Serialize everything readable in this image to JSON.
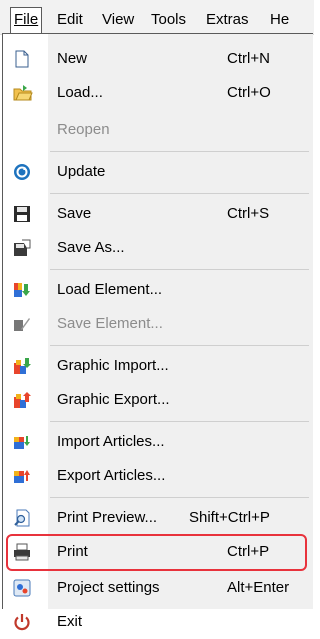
{
  "menubar": {
    "items": [
      {
        "label": "File"
      },
      {
        "label": "Edit"
      },
      {
        "label": "View"
      },
      {
        "label": "Tools"
      },
      {
        "label": "Extras"
      },
      {
        "label": "He"
      }
    ]
  },
  "file_menu": {
    "items": [
      {
        "icon": "new-file-icon",
        "label": "New",
        "shortcut": "Ctrl+N",
        "enabled": true
      },
      {
        "icon": "load-folder-icon",
        "label": "Load...",
        "shortcut": "Ctrl+O",
        "enabled": true
      },
      {
        "icon": "",
        "label": "Reopen",
        "shortcut": "",
        "enabled": false
      },
      {
        "icon": "update-icon",
        "label": "Update",
        "shortcut": "",
        "enabled": true
      },
      {
        "icon": "save-icon",
        "label": "Save",
        "shortcut": "Ctrl+S",
        "enabled": true
      },
      {
        "icon": "save-as-icon",
        "label": "Save As...",
        "shortcut": "",
        "enabled": true
      },
      {
        "icon": "load-element-icon",
        "label": "Load Element...",
        "shortcut": "",
        "enabled": true
      },
      {
        "icon": "save-element-icon",
        "label": "Save Element...",
        "shortcut": "",
        "enabled": false
      },
      {
        "icon": "graphic-import-icon",
        "label": "Graphic Import...",
        "shortcut": "",
        "enabled": true
      },
      {
        "icon": "graphic-export-icon",
        "label": "Graphic Export...",
        "shortcut": "",
        "enabled": true
      },
      {
        "icon": "import-articles-icon",
        "label": "Import Articles...",
        "shortcut": "",
        "enabled": true
      },
      {
        "icon": "export-articles-icon",
        "label": "Export Articles...",
        "shortcut": "",
        "enabled": true
      },
      {
        "icon": "print-preview-icon",
        "label": "Print Preview...",
        "shortcut": "Shift+Ctrl+P",
        "enabled": true
      },
      {
        "icon": "printer-icon",
        "label": "Print",
        "shortcut": "Ctrl+P",
        "enabled": true
      },
      {
        "icon": "project-settings-icon",
        "label": "Project settings",
        "shortcut": "Alt+Enter",
        "enabled": true
      },
      {
        "icon": "exit-power-icon",
        "label": "Exit",
        "shortcut": "",
        "enabled": true
      }
    ]
  },
  "colors": {
    "highlight_border": "#e8323c",
    "disabled_text": "#8c8c8c"
  }
}
